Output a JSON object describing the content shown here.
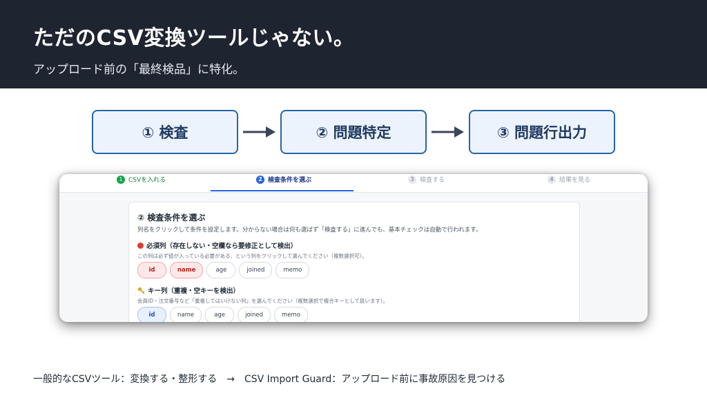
{
  "header": {
    "title": "ただのCSV変換ツールじゃない。",
    "subtitle": "アップロード前の「最終検品」に特化。"
  },
  "flow": {
    "steps": [
      "① 検査",
      "② 問題特定",
      "③ 問題行出力"
    ]
  },
  "app": {
    "stepper": [
      {
        "num": "1",
        "label": "CSVを入れる"
      },
      {
        "num": "2",
        "label": "検査条件を選ぶ"
      },
      {
        "num": "3",
        "label": "検査する"
      },
      {
        "num": "4",
        "label": "結果を見る"
      }
    ],
    "card": {
      "title": "② 検査条件を選ぶ",
      "description": "列名をクリックして条件を設定します。分からない場合は何も選ばず「検査する」に進んでも、基本チェックは自動で行われます。",
      "required": {
        "title": "必須列（存在しない・空欄なら要修正として検出）",
        "description": "この列は必ず値が入っている必要がある、という列をクリックして選んでください（複数選択可）。",
        "columns": [
          "id",
          "name",
          "age",
          "joined",
          "memo"
        ],
        "selected": [
          "id",
          "name"
        ]
      },
      "key": {
        "title": "キー列（重複・空キーを検出）",
        "description": "会員ID・注文番号など「重複してはいけない列」を選んでください（複数選択で複合キーとして扱います）。",
        "columns": [
          "id",
          "name",
          "age",
          "joined",
          "memo"
        ],
        "selected": [
          "id"
        ]
      }
    }
  },
  "footer": {
    "text": "一般的なCSVツール：変換する・整形する　→　CSV Import Guard：アップロード前に事故原因を見つける"
  },
  "colors": {
    "header_bg": "#1e2430",
    "flow_border": "#2563a8",
    "flow_fill": "#edf3fc",
    "accent_blue": "#2563eb",
    "accent_green": "#16a34a",
    "required_red": "#e23b2e"
  },
  "icons": {
    "required": "red-circle-icon",
    "key": "key-icon",
    "flow_arrow": "right-arrow-icon"
  }
}
